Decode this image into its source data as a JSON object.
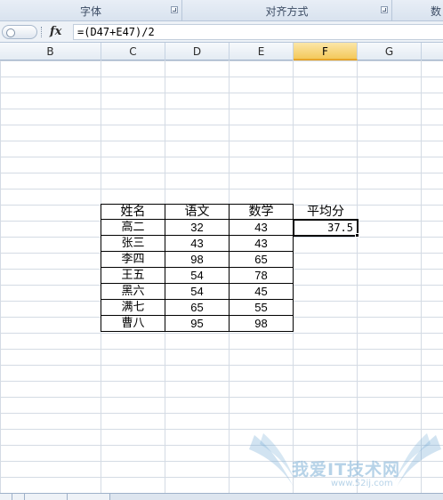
{
  "ribbon": {
    "groups": [
      {
        "label": "字体"
      },
      {
        "label": "对齐方式"
      },
      {
        "label": "数"
      }
    ]
  },
  "formula_bar": {
    "fx_label": "fx",
    "formula": "=(D47+E47)/2"
  },
  "columns": [
    "B",
    "C",
    "D",
    "E",
    "F",
    "G"
  ],
  "selected_column": "F",
  "table": {
    "headers": [
      "姓名",
      "语文",
      "数学"
    ],
    "rows": [
      [
        "高二",
        "32",
        "43"
      ],
      [
        "张三",
        "43",
        "43"
      ],
      [
        "李四",
        "98",
        "65"
      ],
      [
        "王五",
        "54",
        "78"
      ],
      [
        "黑六",
        "54",
        "45"
      ],
      [
        "满七",
        "65",
        "55"
      ],
      [
        "曹八",
        "95",
        "98"
      ]
    ]
  },
  "average": {
    "label": "平均分",
    "value": "37.5"
  },
  "watermark": {
    "text": "我爱IT技术网",
    "url": "www.52ij.com"
  },
  "colors": {
    "selected_header": "#f4c95c",
    "grid_line": "#d4dbe4",
    "watermark": "#7bafd6"
  }
}
